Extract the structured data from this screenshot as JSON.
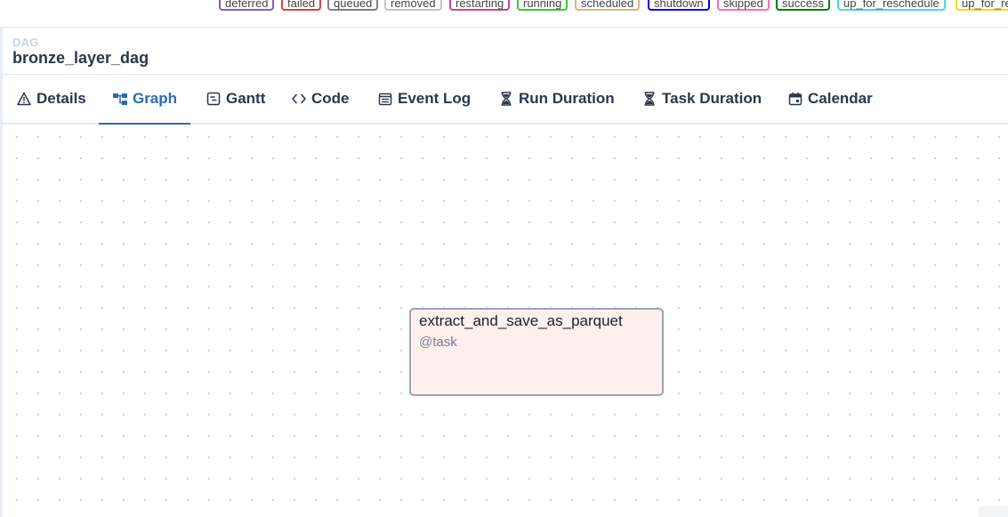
{
  "legend": {
    "states": [
      {
        "label": "deferred",
        "color": "#805ad5"
      },
      {
        "label": "failed",
        "color": "#e53e3e"
      },
      {
        "label": "queued",
        "color": "#808080"
      },
      {
        "label": "removed",
        "color": "#c0c4c8"
      },
      {
        "label": "restarting",
        "color": "#d53f8c"
      },
      {
        "label": "running",
        "color": "#32cd32"
      },
      {
        "label": "scheduled",
        "color": "#d2b48c"
      },
      {
        "label": "shutdown",
        "color": "#0000ff"
      },
      {
        "label": "skipped",
        "color": "#ff69b4"
      },
      {
        "label": "success",
        "color": "#008000"
      },
      {
        "label": "up_for_reschedule",
        "color": "#40e0d0"
      },
      {
        "label": "up_for_re",
        "color": "#ffd700"
      }
    ]
  },
  "header": {
    "label": "DAG",
    "dag_id": "bronze_layer_dag"
  },
  "tabs": [
    {
      "label": "Details",
      "icon": "warning-triangle-icon"
    },
    {
      "label": "Graph",
      "icon": "graph-icon",
      "active": true
    },
    {
      "label": "Gantt",
      "icon": "gantt-icon"
    },
    {
      "label": "Code",
      "icon": "code-icon"
    },
    {
      "label": "Event Log",
      "icon": "event-log-icon"
    },
    {
      "label": "Run Duration",
      "icon": "hourglass-icon"
    },
    {
      "label": "Task Duration",
      "icon": "hourglass-icon"
    },
    {
      "label": "Calendar",
      "icon": "calendar-icon"
    }
  ],
  "graph": {
    "nodes": [
      {
        "task_id": "extract_and_save_as_parquet",
        "operator": "@task",
        "fill": "#fff0ed",
        "border": "#9aa4b1"
      }
    ]
  },
  "colors": {
    "accent": "#2b6cb0",
    "text": "#2d3748"
  }
}
